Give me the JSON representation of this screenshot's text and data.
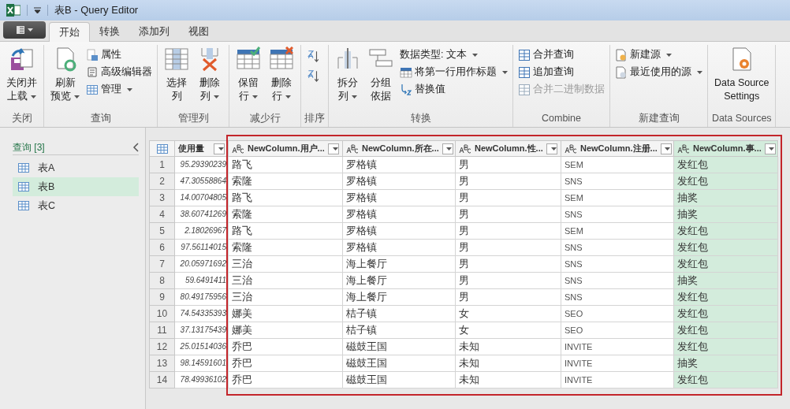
{
  "window": {
    "title": "表B - Query Editor"
  },
  "tabs": [
    {
      "label": "开始",
      "selected": true
    },
    {
      "label": "转换",
      "selected": false
    },
    {
      "label": "添加列",
      "selected": false
    },
    {
      "label": "视图",
      "selected": false
    }
  ],
  "ribbon": [
    {
      "label": "关闭",
      "items": [
        {
          "kind": "large",
          "lines": [
            "关闭并",
            "上载"
          ],
          "dropdown": true,
          "disabled": false
        }
      ]
    },
    {
      "label": "查询",
      "items": [
        {
          "kind": "large",
          "lines": [
            "刷新",
            "预览"
          ],
          "dropdown": true,
          "disabled": false
        },
        {
          "kind": "small",
          "lines": [
            "属性"
          ],
          "dropdown": false,
          "disabled": false
        },
        {
          "kind": "small",
          "lines": [
            "高级编辑器"
          ],
          "dropdown": false,
          "disabled": false
        },
        {
          "kind": "small",
          "lines": [
            "管理"
          ],
          "dropdown": true,
          "disabled": false
        }
      ]
    },
    {
      "label": "管理列",
      "items": [
        {
          "kind": "large",
          "lines": [
            "选择",
            "列"
          ],
          "dropdown": false,
          "disabled": false
        },
        {
          "kind": "large",
          "lines": [
            "删除",
            "列"
          ],
          "dropdown": true,
          "disabled": false
        }
      ]
    },
    {
      "label": "减少行",
      "items": [
        {
          "kind": "large",
          "lines": [
            "保留",
            "行"
          ],
          "dropdown": true,
          "disabled": false
        },
        {
          "kind": "large",
          "lines": [
            "删除",
            "行"
          ],
          "dropdown": true,
          "disabled": false
        }
      ]
    },
    {
      "label": "排序",
      "items": [
        {
          "kind": "icon",
          "dropdown": false,
          "disabled": false
        },
        {
          "kind": "icon",
          "dropdown": false,
          "disabled": false
        }
      ]
    },
    {
      "label": "转换",
      "items": [
        {
          "kind": "large",
          "lines": [
            "拆分",
            "列"
          ],
          "dropdown": true,
          "disabled": false
        },
        {
          "kind": "large",
          "lines": [
            "分组",
            "依据"
          ],
          "dropdown": false,
          "disabled": false
        },
        {
          "kind": "text",
          "lines": [
            "数据类型: 文本"
          ],
          "dropdown": true,
          "disabled": false
        },
        {
          "kind": "small",
          "lines": [
            "将第一行用作标题"
          ],
          "dropdown": true,
          "disabled": false
        },
        {
          "kind": "small",
          "lines": [
            "替换值"
          ],
          "dropdown": false,
          "disabled": false
        }
      ]
    },
    {
      "label": "Combine",
      "items": [
        {
          "kind": "small",
          "lines": [
            "合并查询"
          ],
          "dropdown": false,
          "disabled": false
        },
        {
          "kind": "small",
          "lines": [
            "追加查询"
          ],
          "dropdown": false,
          "disabled": false
        },
        {
          "kind": "small",
          "lines": [
            "合并二进制数据"
          ],
          "dropdown": false,
          "disabled": true
        }
      ]
    },
    {
      "label": "新建查询",
      "items": [
        {
          "kind": "small",
          "lines": [
            "新建源"
          ],
          "dropdown": true,
          "disabled": false
        },
        {
          "kind": "small",
          "lines": [
            "最近使用的源"
          ],
          "dropdown": true,
          "disabled": false
        }
      ]
    },
    {
      "label": "Data Sources",
      "items": [
        {
          "kind": "large",
          "lines": [
            "Data Source",
            "Settings"
          ],
          "dropdown": false,
          "disabled": false
        }
      ]
    }
  ],
  "sidebar": {
    "heading": "查询 [3]",
    "items": [
      {
        "label": "表A",
        "selected": false
      },
      {
        "label": "表B",
        "selected": true
      },
      {
        "label": "表C",
        "selected": false
      }
    ]
  },
  "table": {
    "columns": [
      {
        "label": "使用量",
        "text_type": false,
        "selected": false
      },
      {
        "label": "NewColumn.用户...",
        "text_type": true,
        "selected": false
      },
      {
        "label": "NewColumn.所在...",
        "text_type": true,
        "selected": false
      },
      {
        "label": "NewColumn.性...",
        "text_type": true,
        "selected": false
      },
      {
        "label": "NewColumn.注册...",
        "text_type": true,
        "selected": false
      },
      {
        "label": "NewColumn.事...",
        "text_type": true,
        "selected": true
      }
    ],
    "rows": [
      {
        "index": "1",
        "cells": [
          "95.29390239",
          "路飞",
          "罗格镇",
          "男",
          "SEM",
          "发红包"
        ]
      },
      {
        "index": "2",
        "cells": [
          "47.30558864",
          "索隆",
          "罗格镇",
          "男",
          "SNS",
          "发红包"
        ]
      },
      {
        "index": "3",
        "cells": [
          "14.00704805",
          "路飞",
          "罗格镇",
          "男",
          "SEM",
          "抽奖"
        ]
      },
      {
        "index": "4",
        "cells": [
          "38.60741269",
          "索隆",
          "罗格镇",
          "男",
          "SNS",
          "抽奖"
        ]
      },
      {
        "index": "5",
        "cells": [
          "2.18026967",
          "路飞",
          "罗格镇",
          "男",
          "SEM",
          "发红包"
        ]
      },
      {
        "index": "6",
        "cells": [
          "97.56114015",
          "索隆",
          "罗格镇",
          "男",
          "SNS",
          "发红包"
        ]
      },
      {
        "index": "7",
        "cells": [
          "20.05971692",
          "三治",
          "海上餐厅",
          "男",
          "SNS",
          "发红包"
        ]
      },
      {
        "index": "8",
        "cells": [
          "59.6491411",
          "三治",
          "海上餐厅",
          "男",
          "SNS",
          "抽奖"
        ]
      },
      {
        "index": "9",
        "cells": [
          "80.49175956",
          "三治",
          "海上餐厅",
          "男",
          "SNS",
          "发红包"
        ]
      },
      {
        "index": "10",
        "cells": [
          "74.54335393",
          "娜美",
          "桔子镇",
          "女",
          "SEO",
          "发红包"
        ]
      },
      {
        "index": "11",
        "cells": [
          "37.13175439",
          "娜美",
          "桔子镇",
          "女",
          "SEO",
          "发红包"
        ]
      },
      {
        "index": "12",
        "cells": [
          "25.01514036",
          "乔巴",
          "磁鼓王国",
          "未知",
          "INVITE",
          "发红包"
        ]
      },
      {
        "index": "13",
        "cells": [
          "98.14591601",
          "乔巴",
          "磁鼓王国",
          "未知",
          "INVITE",
          "抽奖"
        ]
      },
      {
        "index": "14",
        "cells": [
          "78.49936102",
          "乔巴",
          "磁鼓王国",
          "未知",
          "INVITE",
          "发红包"
        ]
      }
    ]
  }
}
